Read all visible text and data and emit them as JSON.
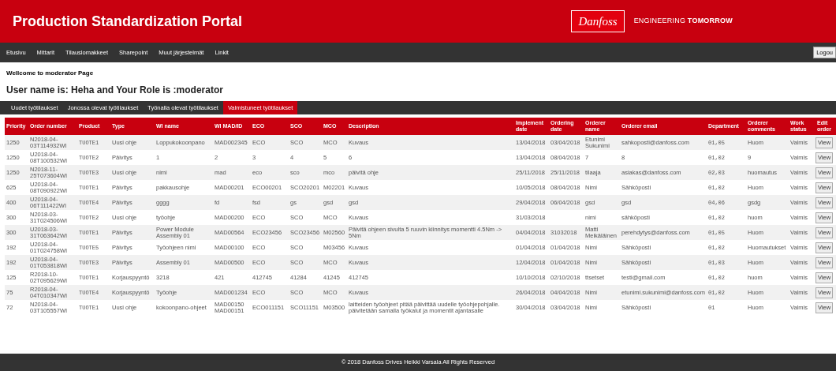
{
  "header": {
    "title": "Production Standardization Portal",
    "logo_text": "Danfoss",
    "tagline": "ENGINEERING **TOMORROW**"
  },
  "nav": {
    "items": [
      "Etusivu",
      "Mittarit",
      "Tilauslomakkeet",
      "Sharepoint",
      "Muut järjestelmät",
      "Linkit"
    ],
    "logout": "Logou"
  },
  "welcome": "Wellcome to moderator Page",
  "user_line": "User name is: Heha and Your Role is :moderator",
  "tabs": [
    {
      "label": "Uudet työtilaukset",
      "selected": false
    },
    {
      "label": "Jonossa olevat työtilaukset",
      "selected": false
    },
    {
      "label": "Työnalla olevat työtilaukset",
      "selected": false
    },
    {
      "label": "Valmistuneet työtilaukset",
      "selected": true
    }
  ],
  "table": {
    "columns": [
      "Priority",
      "Order number",
      "Product",
      "Type",
      "WI name",
      "WI MAD/ID",
      "ECO",
      "SCO",
      "MCO",
      "Description",
      "Implement date",
      "Ordering date",
      "Orderer name",
      "Orderer email",
      "Department",
      "Orderer comments",
      "Work status",
      "Edit order"
    ],
    "rows": [
      {
        "cells": [
          "1250",
          "N2018-04-03T114932WI",
          "TUOTE1",
          "Uusi ohje",
          "Loppukokoonpano",
          "MAD002345",
          "ECO",
          "SCO",
          "MCO",
          "Kuvaus",
          "13/04/2018",
          "03/04/2018",
          "Etunimi Sukunimi",
          "sahkoposti@danfoss.com",
          "01,05",
          "Huom",
          "Valmis"
        ],
        "action": "View"
      },
      {
        "cells": [
          "1250",
          "U2018-04-08T100532WI",
          "TUOTE2",
          "Päivitys",
          "1",
          "2",
          "3",
          "4",
          "5",
          "6",
          "13/04/2018",
          "08/04/2018",
          "7",
          "8",
          "01,02",
          "9",
          "Valmis"
        ],
        "action": "View"
      },
      {
        "cells": [
          "1250",
          "N2018-11-25T073604WI",
          "TUOTE3",
          "Uusi ohje",
          "nimi",
          "mad",
          "eco",
          "sco",
          "mco",
          "päivitä ohje",
          "25/11/2018",
          "25/11/2018",
          "tilaaja",
          "asiakas@danfoss.com",
          "02,03",
          "huomautus",
          "Valmis"
        ],
        "action": "View"
      },
      {
        "cells": [
          "625",
          "U2018-04-08T090922WI",
          "TUOTE1",
          "Päivitys",
          "pakkausohje",
          "MAD00201",
          "ECO00201",
          "SCO20201",
          "M02201",
          "Kuvaus",
          "10/05/2018",
          "08/04/2018",
          "Nimi",
          "Sähköposti",
          "01,02",
          "Huom",
          "Valmis"
        ],
        "action": "View"
      },
      {
        "cells": [
          "400",
          "U2018-04-06T111422WI",
          "TUOTE4",
          "Päivitys",
          "gggg",
          "fd",
          "fsd",
          "gs",
          "gsd",
          "gsd",
          "29/04/2018",
          "06/04/2018",
          "gsd",
          "gsd",
          "04,06",
          "gsdg",
          "Valmis"
        ],
        "action": "View"
      },
      {
        "cells": [
          "300",
          "N2018-03-31T024506WI",
          "TUOTE2",
          "Uusi ohje",
          "työohje",
          "MAD00200",
          "ECO",
          "SCO",
          "MCO",
          "Kuvaus",
          "31/03/2018",
          "",
          "nimi",
          "sähköposti",
          "01,02",
          "huom",
          "Valmis"
        ],
        "action": "View"
      },
      {
        "cells": [
          "300",
          "U2018-03-31T063642WI",
          "TUOTE1",
          "Päivitys",
          "Power Module Assembly 01",
          "MAD00564",
          "ECO23456",
          "SCO23456",
          "M02560",
          "Päivitä ohjeen sivulta 5 ruuvin kiinnitys momentti 4.5Nm -> 5Nm",
          "04/04/2018",
          "31032018",
          "Matti Meikäläinen",
          "perehdytys@danfoss.com",
          "01,05",
          "Huom",
          "Valmis"
        ],
        "action": "View"
      },
      {
        "cells": [
          "192",
          "U2018-04-01T024758WI",
          "TUOTE5",
          "Päivitys",
          "Työohjeen nimi",
          "MAD00100",
          "ECO",
          "SCO",
          "M03456",
          "Kuvaus",
          "01/04/2018",
          "01/04/2018",
          "Nimi",
          "Sähköposti",
          "01,02",
          "Huomautukset",
          "Valmis"
        ],
        "action": "View"
      },
      {
        "cells": [
          "192",
          "U2018-04-01T053818WI",
          "TUOTE3",
          "Päivitys",
          "Assembly 01",
          "MAD00500",
          "ECO",
          "SCO",
          "MCO",
          "Kuvaus",
          "12/04/2018",
          "01/04/2018",
          "Nimi",
          "Sähköposti",
          "01,03",
          "Huom",
          "Valmis"
        ],
        "action": "View"
      },
      {
        "cells": [
          "125",
          "R2018-10-02T095629WI",
          "TUOTE1",
          "Korjauspyyntö",
          "3218",
          "421",
          "412745",
          "41284",
          "41245",
          "412745",
          "10/10/2018",
          "02/10/2018",
          "ttsetset",
          "testi@gmail.com",
          "01,02",
          "huom",
          "Valmis"
        ],
        "action": "View"
      },
      {
        "cells": [
          "75",
          "R2018-04-04T010347WI",
          "TUOTE4",
          "Korjauspyyntö",
          "Työohje",
          "MAD001234",
          "ECO",
          "SCO",
          "MCO",
          "Kuvaus",
          "26/04/2018",
          "04/04/2018",
          "Nimi",
          "etunimi.sukunimi@danfoss.com",
          "01,02",
          "Huom",
          "Valmis"
        ],
        "action": "View"
      },
      {
        "cells": [
          "72",
          "N2018-04-03T105557WI",
          "TUOTE1",
          "Uusi ohje",
          "kokoonpano-ohjeet",
          "MAD00150 MAD00151",
          "ECO011151",
          "SCO11151",
          "M03500",
          "laitteiden työohjeet pitää päivittää uudelle työohjepohjalle. päivitetään samalla työkalut ja momentit ajantasalle",
          "30/04/2018",
          "03/04/2018",
          "Nimi",
          "Sähköposti",
          "01",
          "Huom",
          "Valmis"
        ],
        "action": "View"
      }
    ]
  },
  "footer": "© 2018 Danfoss Drives Heikki Varsala All Rights Reserved"
}
